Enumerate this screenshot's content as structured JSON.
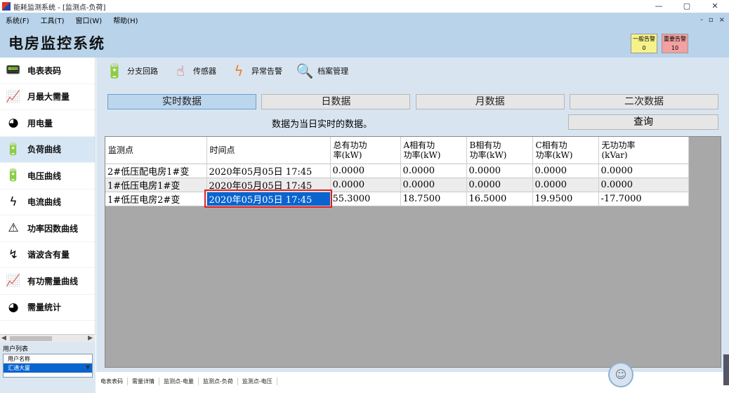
{
  "window": {
    "title": "能耗监测系统 - [监测点-负荷]",
    "minimize": "—",
    "maximize": "▢",
    "close": "✕"
  },
  "menu": {
    "items": [
      "系统(F)",
      "工具(T)",
      "窗口(W)",
      "帮助(H)"
    ],
    "mdi": [
      "-",
      "▫",
      "×"
    ]
  },
  "header": {
    "title": "电房监控系统",
    "alarms": [
      {
        "label": "一般告警",
        "count": "0",
        "color": "#f6f28a"
      },
      {
        "label": "重要告警",
        "count": "10",
        "color": "#f2a0a0"
      }
    ]
  },
  "sidebar": {
    "items": [
      {
        "label": "电表表码",
        "icon": "meter-icon"
      },
      {
        "label": "月最大需量",
        "icon": "chart-icon"
      },
      {
        "label": "用电量",
        "icon": "pie-chart-icon"
      },
      {
        "label": "负荷曲线",
        "icon": "transformer-icon"
      },
      {
        "label": "电压曲线",
        "icon": "transformer-icon"
      },
      {
        "label": "电流曲线",
        "icon": "lightning-icon"
      },
      {
        "label": "功率因数曲线",
        "icon": "transformer-warning-icon"
      },
      {
        "label": "谐波含有量",
        "icon": "bolt-icon"
      },
      {
        "label": "有功需量曲线",
        "icon": "chart-icon"
      },
      {
        "label": "需量统计",
        "icon": "pie-chart-icon"
      }
    ],
    "active_index": 3
  },
  "user_panel": {
    "title": "用户列表",
    "column": "用户名称",
    "selected": "汇通大厦"
  },
  "toolbar": [
    {
      "label": "分支回路",
      "icon": "transformer-icon"
    },
    {
      "label": "传感器",
      "icon": "touch-icon"
    },
    {
      "label": "异常告警",
      "icon": "lightning-icon"
    },
    {
      "label": "档案管理",
      "icon": "magnifier-icon"
    }
  ],
  "tabs": [
    "实时数据",
    "日数据",
    "月数据",
    "二次数据"
  ],
  "active_tab": 0,
  "description": "数据为当日实时的数据。",
  "query_label": "查询",
  "table": {
    "headers": [
      "监测点",
      "时间点",
      "总有功功\n率(kW)",
      "A相有功\n功率(kW)",
      "B相有功\n功率(kW)",
      "C相有功\n功率(kW)",
      "无功功率\n(kVar)"
    ],
    "rows": [
      [
        "2#低压配电房1#变",
        "2020年05月05日  17:45",
        "0.0000",
        "0.0000",
        "0.0000",
        "0.0000",
        "0.0000"
      ],
      [
        "1#低压电房1#变",
        "2020年05月05日  17:45",
        "0.0000",
        "0.0000",
        "0.0000",
        "0.0000",
        "0.0000"
      ],
      [
        "1#低压电房2#变",
        "2020年05月05日  17:45",
        "55.3000",
        "18.7500",
        "16.5000",
        "19.9500",
        "-17.7000"
      ]
    ],
    "selected_cell": [
      2,
      1
    ]
  },
  "bottom_tabs": [
    "电表表码",
    "需量详情",
    "监测点-电量",
    "监测点-负荷",
    "监测点-电压"
  ]
}
